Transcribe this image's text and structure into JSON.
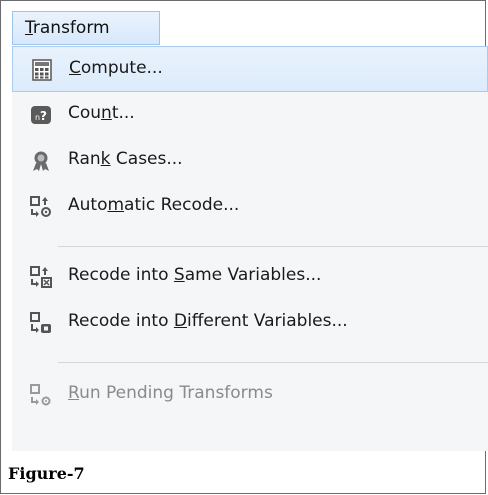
{
  "menu": {
    "title_pre": "",
    "title_ul": "T",
    "title_post": "ransform"
  },
  "items": [
    {
      "pre": "",
      "ul": "C",
      "post": "ompute...",
      "icon": "calculator-icon"
    },
    {
      "pre": "Cou",
      "ul": "n",
      "post": "t...",
      "icon": "count-icon"
    },
    {
      "pre": "Ran",
      "ul": "k",
      "post": " Cases...",
      "icon": "rank-cases-icon"
    },
    {
      "pre": "Auto",
      "ul": "m",
      "post": "atic Recode...",
      "icon": "automatic-recode-icon"
    },
    {
      "pre": "Recode into ",
      "ul": "S",
      "post": "ame Variables...",
      "icon": "recode-same-icon"
    },
    {
      "pre": "Recode into ",
      "ul": "D",
      "post": "ifferent Variables...",
      "icon": "recode-different-icon"
    },
    {
      "pre": "",
      "ul": "R",
      "post": "un Pending Transforms",
      "icon": "run-pending-icon"
    }
  ],
  "caption": "Figure-7",
  "colors": {
    "highlight": "#dcebfb",
    "disabled_text": "#8a8a8a"
  }
}
